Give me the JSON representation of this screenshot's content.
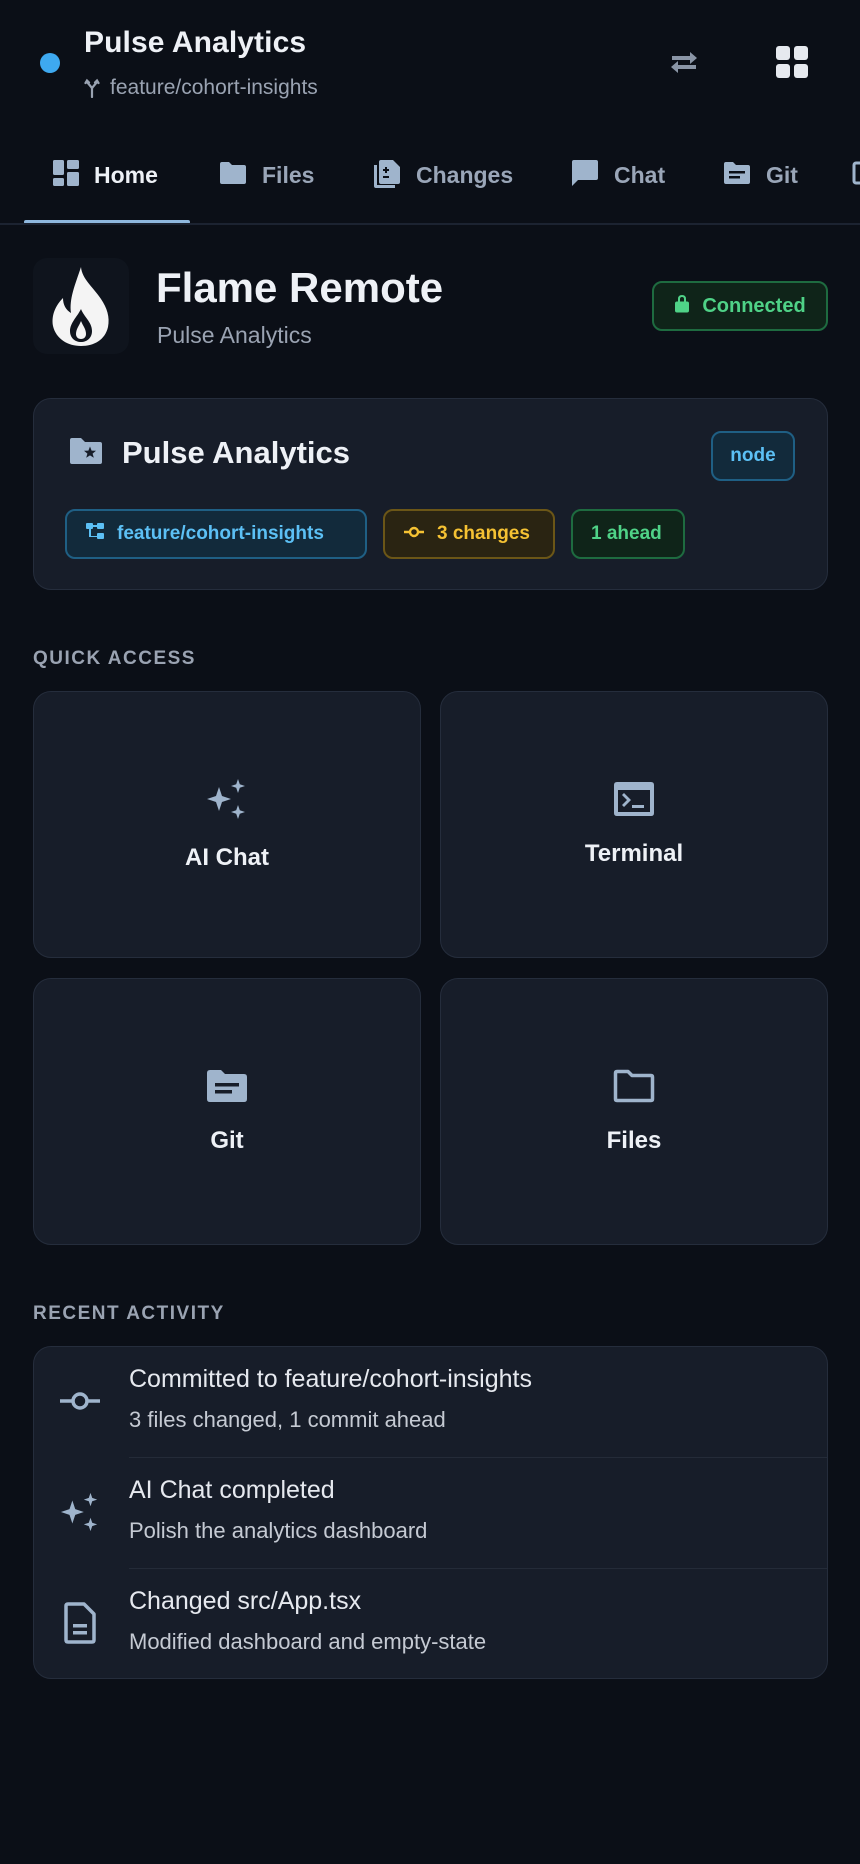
{
  "header": {
    "title": "Pulse Analytics",
    "branch": "feature/cohort-insights",
    "status_color": "#3ea9f0",
    "icons": [
      "swap-horiz-icon",
      "apps-grid-icon"
    ]
  },
  "tabs": [
    {
      "label": "Home",
      "icon": "dashboard-icon",
      "active": true
    },
    {
      "label": "Files",
      "icon": "folder-icon",
      "active": false
    },
    {
      "label": "Changes",
      "icon": "diff-icon",
      "active": false
    },
    {
      "label": "Chat",
      "icon": "chat-icon",
      "active": false
    },
    {
      "label": "Git",
      "icon": "git-folder-icon",
      "active": false
    }
  ],
  "hero": {
    "title": "Flame Remote",
    "subtitle": "Pulse Analytics",
    "status_label": "Connected",
    "logo": "flame-logo"
  },
  "project": {
    "name": "Pulse Analytics",
    "runtime": "node",
    "branch": "feature/cohort-insights",
    "changes": "3 changes",
    "ahead": "1 ahead"
  },
  "quick_access": {
    "title": "QUICK ACCESS",
    "items": [
      {
        "label": "AI Chat",
        "icon": "sparkles-icon"
      },
      {
        "label": "Terminal",
        "icon": "terminal-icon"
      },
      {
        "label": "Git",
        "icon": "git-folder-icon"
      },
      {
        "label": "Files",
        "icon": "folder-outline-icon"
      }
    ]
  },
  "recent_activity": {
    "title": "RECENT ACTIVITY",
    "items": [
      {
        "title": "Committed to feature/cohort-insights",
        "subtitle": "3 files changed, 1 commit ahead",
        "icon": "commit-icon"
      },
      {
        "title": "AI Chat completed",
        "subtitle": "Polish the analytics dashboard",
        "icon": "sparkles-icon"
      },
      {
        "title": "Changed src/App.tsx",
        "subtitle": "Modified dashboard and empty-state",
        "icon": "document-icon"
      }
    ]
  },
  "colors": {
    "background": "#0b0f17",
    "card": "#171d29",
    "accent_blue": "#5cc0f5",
    "accent_green": "#4fd287",
    "accent_yellow": "#f5c233"
  }
}
